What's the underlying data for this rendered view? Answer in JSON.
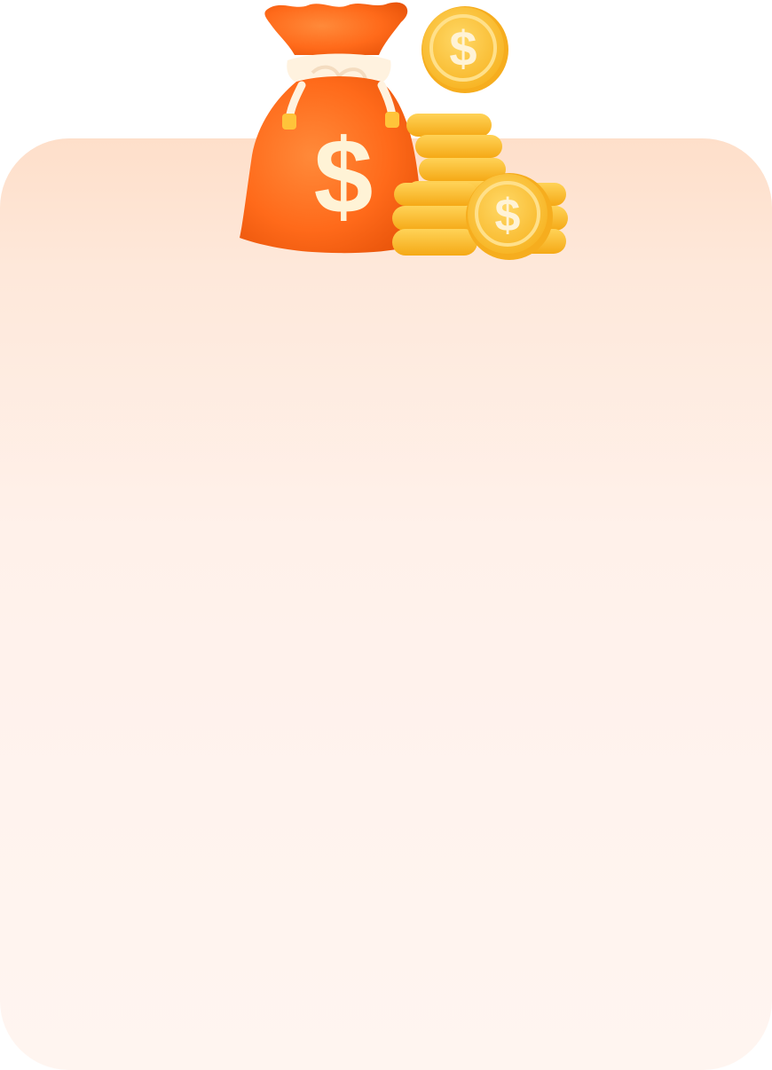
{
  "card": {
    "background_top": "#fedfca",
    "background_bottom": "#fff5f0"
  },
  "illustration": {
    "icons": [
      "money-bag-icon",
      "coin-stack-icon",
      "floating-coin-icon",
      "front-coin-icon"
    ],
    "colors": {
      "bag": "#ff6a1a",
      "bag_shadow": "#e8540a",
      "rope": "#fff2df",
      "coin": "#ffc43a",
      "coin_edge": "#f6ad1e",
      "coin_symbol": "#fff3d6"
    }
  }
}
